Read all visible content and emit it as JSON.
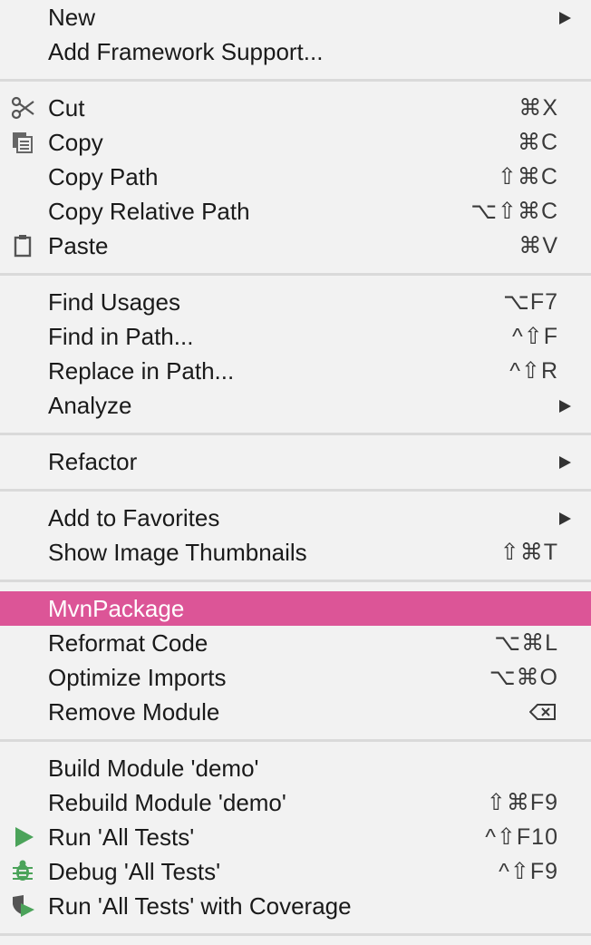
{
  "menu": {
    "groups": [
      {
        "items": [
          {
            "label": "New",
            "submenu": true
          },
          {
            "label": "Add Framework Support..."
          }
        ]
      },
      {
        "items": [
          {
            "label": "Cut",
            "shortcut": "⌘X",
            "icon": "scissors-icon"
          },
          {
            "label": "Copy",
            "shortcut": "⌘C",
            "icon": "copy-icon"
          },
          {
            "label": "Copy Path",
            "shortcut": "⇧⌘C"
          },
          {
            "label": "Copy Relative Path",
            "shortcut": "⌥⇧⌘C"
          },
          {
            "label": "Paste",
            "shortcut": "⌘V",
            "icon": "clipboard-icon"
          }
        ]
      },
      {
        "items": [
          {
            "label": "Find Usages",
            "shortcut": "⌥F7"
          },
          {
            "label": "Find in Path...",
            "shortcut": "^⇧F"
          },
          {
            "label": "Replace in Path...",
            "shortcut": "^⇧R"
          },
          {
            "label": "Analyze",
            "submenu": true
          }
        ]
      },
      {
        "items": [
          {
            "label": "Refactor",
            "submenu": true
          }
        ]
      },
      {
        "items": [
          {
            "label": "Add to Favorites",
            "submenu": true
          },
          {
            "label": "Show Image Thumbnails",
            "shortcut": "⇧⌘T"
          }
        ]
      },
      {
        "items": [
          {
            "label": "MvnPackage",
            "active": true
          },
          {
            "label": "Reformat Code",
            "shortcut": "⌥⌘L"
          },
          {
            "label": "Optimize Imports",
            "shortcut": "⌥⌘O"
          },
          {
            "label": "Remove Module",
            "shortcut_icon": "delete-key-icon"
          }
        ]
      },
      {
        "items": [
          {
            "label": "Build Module 'demo'"
          },
          {
            "label": "Rebuild Module 'demo'",
            "shortcut": "⇧⌘F9"
          },
          {
            "label": "Run 'All Tests'",
            "shortcut": "^⇧F10",
            "icon": "run-icon"
          },
          {
            "label": "Debug 'All Tests'",
            "shortcut": "^⇧F9",
            "icon": "debug-icon"
          },
          {
            "label": "Run 'All Tests' with Coverage",
            "icon": "coverage-icon"
          }
        ]
      }
    ],
    "colors": {
      "background": "#f2f2f2",
      "highlight": "#dc5597",
      "separator": "#dadada",
      "run_green": "#4ba35a"
    }
  }
}
